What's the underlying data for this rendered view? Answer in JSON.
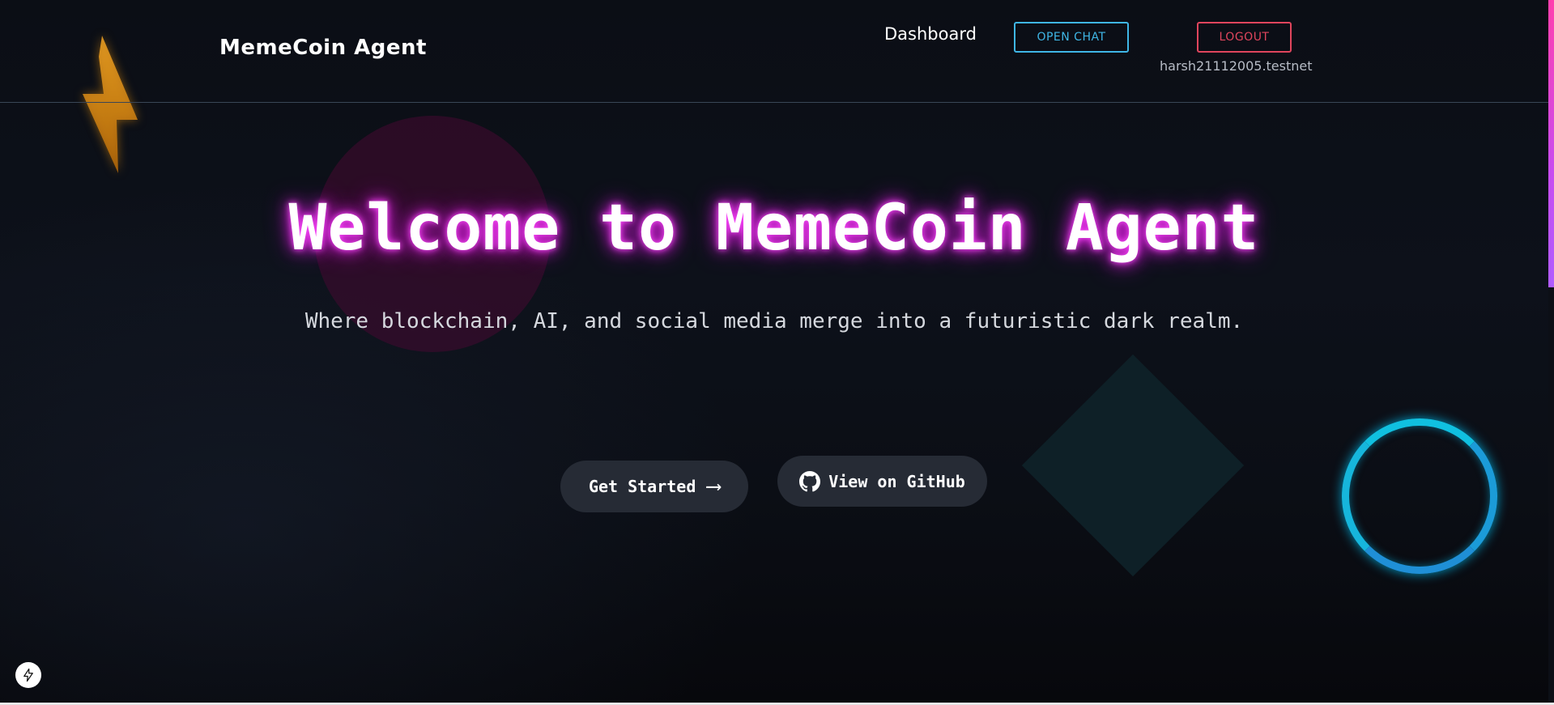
{
  "header": {
    "logo": "MemeCoin Agent",
    "nav_dashboard": "Dashboard",
    "open_chat_label": "OPEN CHAT",
    "logout_label": "LOGOUT",
    "user_id": "harsh21112005.testnet"
  },
  "hero": {
    "title": "Welcome to MemeCoin Agent",
    "subtitle": "Where blockchain, AI, and social media merge into a futuristic dark realm.",
    "get_started_label": "Get Started",
    "get_started_icon": "arrow-right-icon",
    "github_label": "View on GitHub",
    "github_icon": "github-icon"
  },
  "decorations": {
    "bolt_icon": "lightning-bolt-icon",
    "badge_icon": "bolt-badge-icon"
  },
  "colors": {
    "open_chat": "#3fb6e6",
    "logout": "#e0455d",
    "title_glow": "#e020e0",
    "ring": "#1aa8d8",
    "bolt": "#f0a020"
  }
}
